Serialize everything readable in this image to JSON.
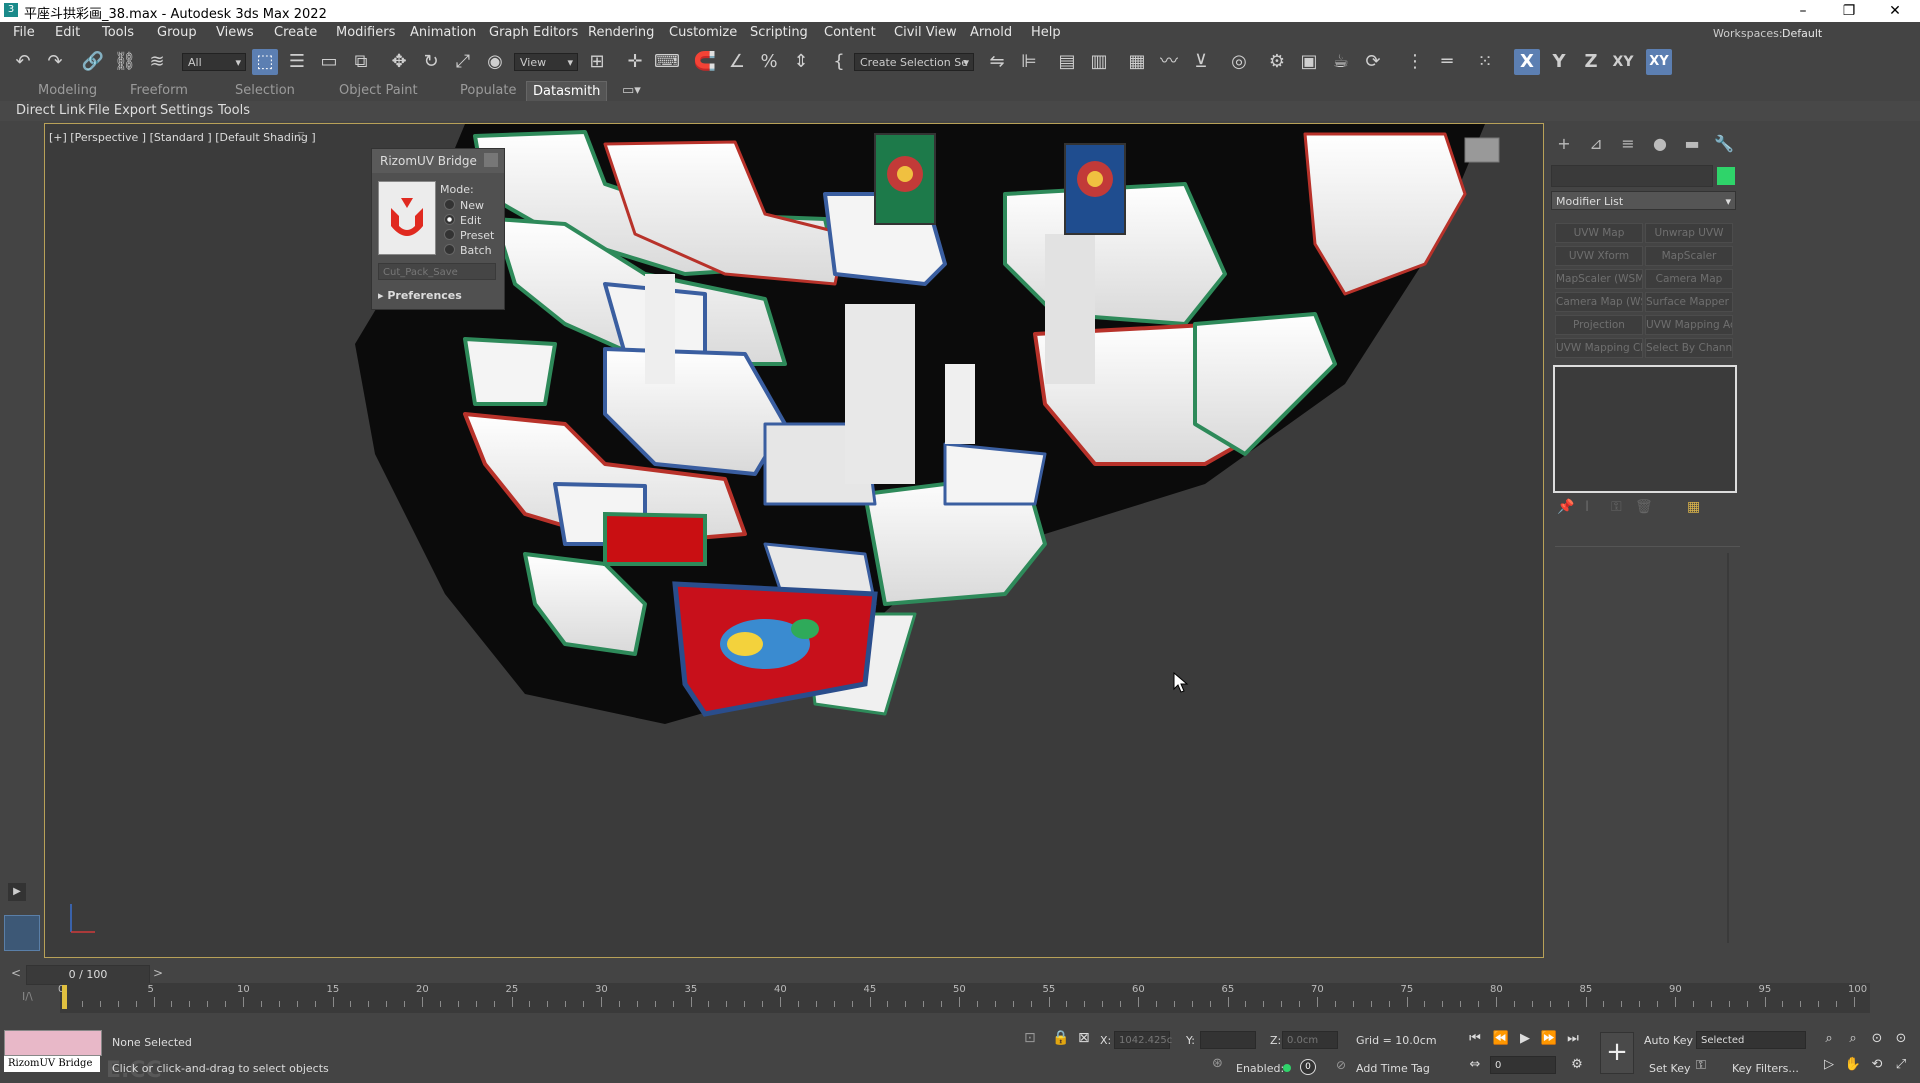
{
  "window": {
    "title": "平座斗拱彩画_38.max - Autodesk 3ds Max 2022",
    "minimize": "–",
    "restore": "❐",
    "close": "✕"
  },
  "menu": [
    "File",
    "Edit",
    "Tools",
    "Group",
    "Views",
    "Create",
    "Modifiers",
    "Animation",
    "Graph Editors",
    "Rendering",
    "Customize",
    "Scripting",
    "Content",
    "Civil View",
    "Arnold",
    "Help"
  ],
  "workspaces": {
    "label": "Workspaces:",
    "value": "Default"
  },
  "toolbar": {
    "filter": "All",
    "ref_coord": "View",
    "selection_set": "Create Selection Se",
    "axis_x": "X",
    "axis_y": "Y",
    "axis_z": "Z",
    "axis_xy": "XY",
    "axis_xy2": "XY"
  },
  "ribbon_tabs": [
    "Modeling",
    "Freeform",
    "Selection",
    "Object Paint",
    "Populate",
    "Datasmith"
  ],
  "sub_tabs": [
    "Direct Link",
    "File Export",
    "Settings",
    "Tools"
  ],
  "viewport": {
    "label": "[+] [Perspective ] [Standard ] [Default Shading ]"
  },
  "rizom": {
    "title": "RizomUV Bridge",
    "mode_label": "Mode:",
    "modes": [
      "New",
      "Edit",
      "Preset",
      "Batch"
    ],
    "selected_mode": "Edit",
    "preset_dropdown": "Cut_Pack_Save",
    "preferences": "Preferences"
  },
  "command_panel": {
    "modifier_list": "Modifier List",
    "color": "#2fd46a",
    "buttons": [
      "UVW Map",
      "Unwrap UVW",
      "UVW Xform",
      "MapScaler",
      "MapScaler (WSM)",
      "Camera Map",
      "Camera Map (WSI",
      "Surface Mapper (",
      "Projection",
      "UVW Mapping Add",
      "UVW Mapping Cle",
      "Select By Channel"
    ]
  },
  "timeline": {
    "frame_counter": "0 / 100",
    "prev": "<",
    "next": ">",
    "ticks": [
      "0",
      "5",
      "10",
      "15",
      "20",
      "25",
      "30",
      "35",
      "40",
      "45",
      "50",
      "55",
      "60",
      "65",
      "70",
      "75",
      "80",
      "85",
      "90",
      "95",
      "100"
    ]
  },
  "status": {
    "maxscript_label": "RizomUV Bridge",
    "selection": "None Selected",
    "prompt": "Click or click-and-drag to select objects",
    "x_label": "X:",
    "x_value": "1042.425c",
    "y_label": "Y:",
    "y_value": "",
    "z_label": "Z:",
    "z_value": "0.0cm",
    "grid": "Grid = 10.0cm",
    "enabled_label": "Enabled:",
    "add_time_tag": "Add Time Tag",
    "auto_key": "Auto Key",
    "key_mode": "Selected",
    "set_key": "Set Key",
    "key_filters": "Key Filters...",
    "current_frame": "0",
    "watermark": "E.CC"
  }
}
